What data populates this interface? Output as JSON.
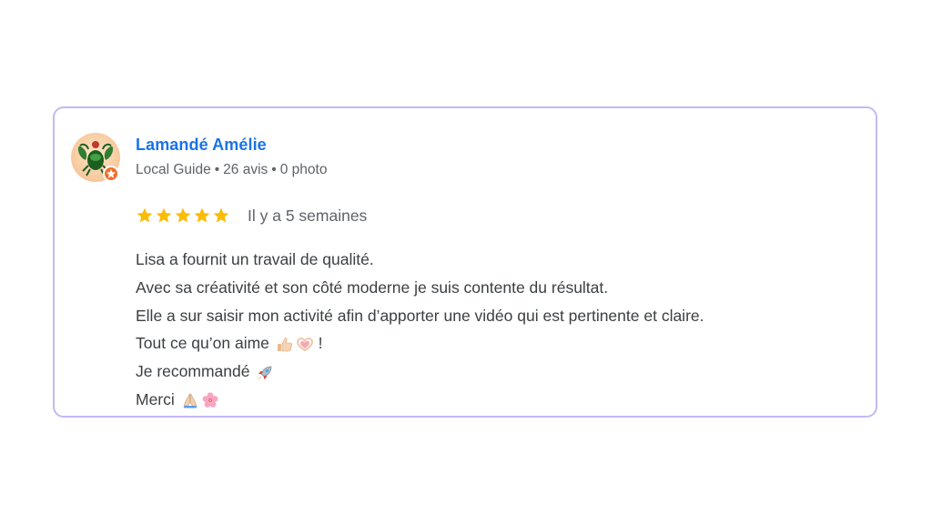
{
  "review": {
    "author_name": "Lamandé Amélie",
    "meta": {
      "badge": "Local Guide",
      "reviews": "26 avis",
      "photos": "0 photo",
      "separator": "•"
    },
    "rating": 5,
    "rating_max": 5,
    "star_color": "#fbbc04",
    "date": "Il y a 5 semaines",
    "lines": {
      "l1": "Lisa a fournit un travail de qualité.",
      "l2": "Avec sa créativité et son côté moderne je suis contente du résultat.",
      "l3": "Elle a sur saisir mon activité afin d’apporter une vidéo qui est pertinente et claire.",
      "l4": "Tout ce qu’on aime",
      "l4_end": " !",
      "l5": "Je recommandé",
      "l6": "Merci"
    },
    "emojis": [
      "thumbs-up",
      "heart-hands",
      "rocket",
      "folded-hands",
      "cherry-blossom"
    ]
  },
  "colors": {
    "name": "#1a73e8",
    "meta_text": "#5f6368",
    "body_text": "#3c4043",
    "card_border": "#c5b8f3",
    "local_guide_badge": "#f06e2b"
  }
}
